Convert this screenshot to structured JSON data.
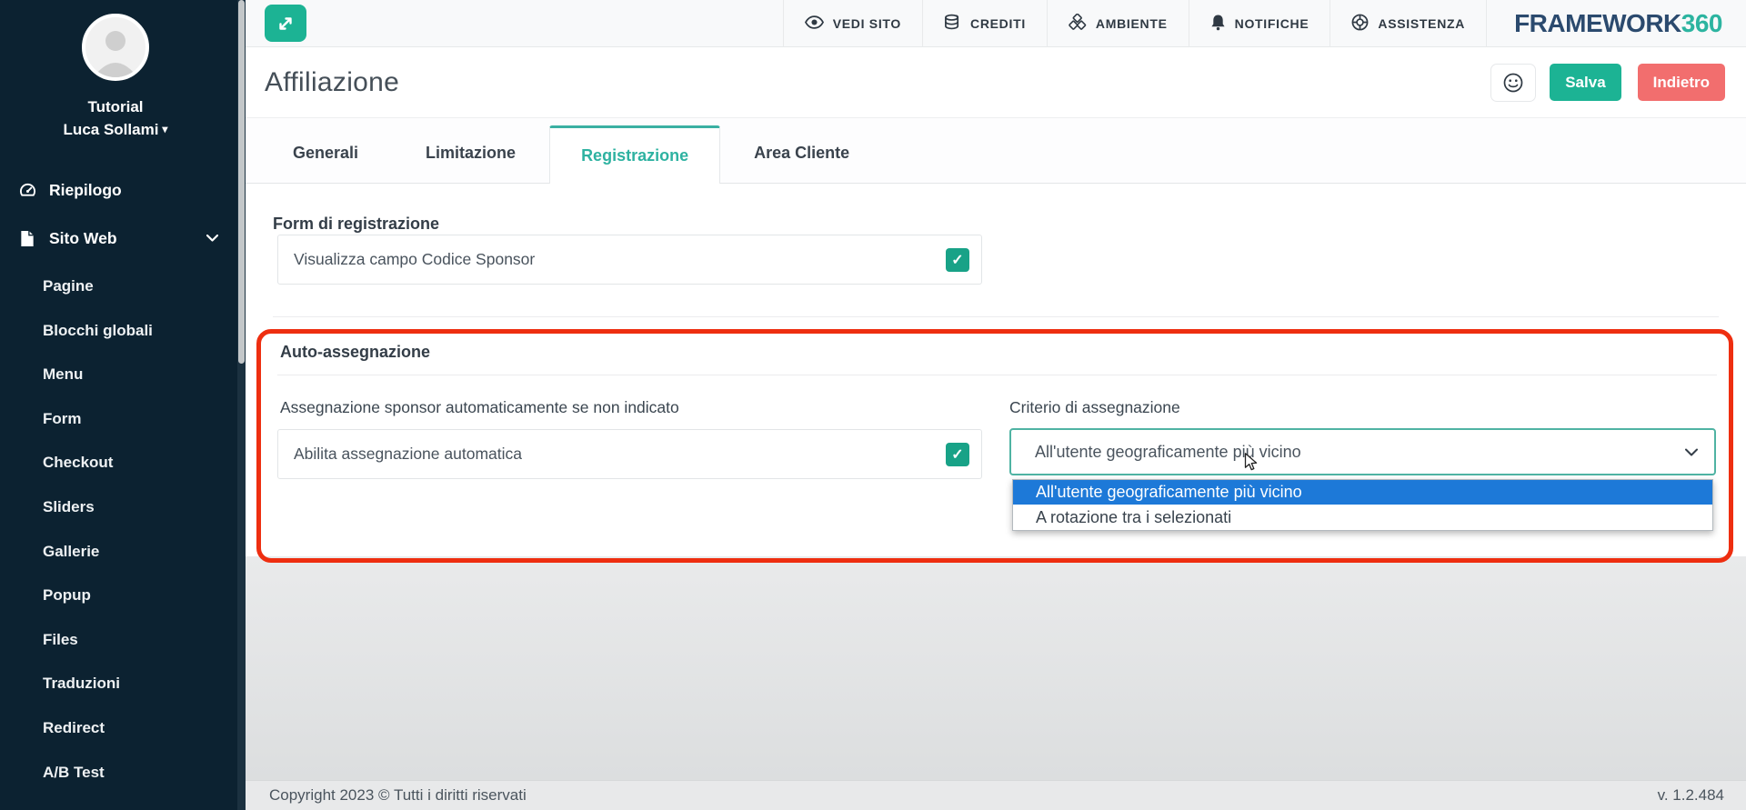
{
  "topbar": {
    "menu": [
      {
        "label": "VEDI SITO",
        "icon": "eye-icon"
      },
      {
        "label": "CREDITI",
        "icon": "coins-icon"
      },
      {
        "label": "AMBIENTE",
        "icon": "cubes-icon"
      },
      {
        "label": "NOTIFICHE",
        "icon": "bell-icon"
      },
      {
        "label": "ASSISTENZA",
        "icon": "life-ring-icon"
      }
    ],
    "logo": {
      "text_primary": "FRAMEWORK",
      "text_accent": "360"
    }
  },
  "sidebar": {
    "profile": {
      "workspace": "Tutorial",
      "user": "Luca Sollami"
    },
    "items": [
      {
        "label": "Riepilogo",
        "icon": "gauge-icon"
      },
      {
        "label": "Sito Web",
        "icon": "page-icon",
        "expanded": true
      }
    ],
    "subitems": [
      "Pagine",
      "Blocchi globali",
      "Menu",
      "Form",
      "Checkout",
      "Sliders",
      "Gallerie",
      "Popup",
      "Files",
      "Traduzioni",
      "Redirect",
      "A/B Test"
    ]
  },
  "header": {
    "title": "Affiliazione",
    "save_label": "Salva",
    "back_label": "Indietro"
  },
  "tabs": [
    {
      "label": "Generali",
      "active": false
    },
    {
      "label": "Limitazione",
      "active": false
    },
    {
      "label": "Registrazione",
      "active": true
    },
    {
      "label": "Area Cliente",
      "active": false
    }
  ],
  "content": {
    "section_registration": {
      "heading": "Form di registrazione",
      "row_label": "Visualizza campo Codice Sponsor",
      "checked": true
    },
    "section_auto_assign": {
      "heading": "Auto-assegnazione",
      "left_label": "Assegnazione sponsor automaticamente se non indicato",
      "row_label": "Abilita assegnazione automatica",
      "checked": true,
      "right_label": "Criterio di assegnazione",
      "select": {
        "value": "All'utente geograficamente più vicino",
        "options": [
          "All'utente geograficamente più vicino",
          "A rotazione tra i selezionati"
        ],
        "highlighted_index": 0
      }
    }
  },
  "footer": {
    "copyright": "Copyright 2023 © Tutti i diritti riservati",
    "version": "v. 1.2.484"
  },
  "colors": {
    "teal": "#1cb394",
    "back_red": "#f26e6e",
    "annotation_red": "#ee2e10",
    "highlight_blue": "#1d79d8",
    "checkbox_green": "#18a287",
    "logo_navy": "#2b4a6e",
    "sidebar_bg": "#0c2231"
  }
}
